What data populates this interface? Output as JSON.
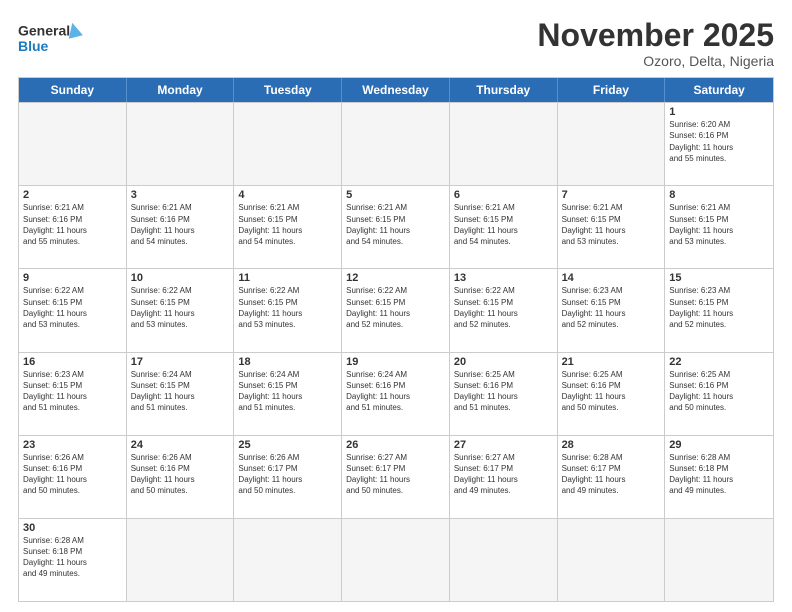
{
  "header": {
    "logo_general": "General",
    "logo_blue": "Blue",
    "month_title": "November 2025",
    "location": "Ozoro, Delta, Nigeria"
  },
  "days_of_week": [
    "Sunday",
    "Monday",
    "Tuesday",
    "Wednesday",
    "Thursday",
    "Friday",
    "Saturday"
  ],
  "weeks": [
    [
      {
        "day": "",
        "text": ""
      },
      {
        "day": "",
        "text": ""
      },
      {
        "day": "",
        "text": ""
      },
      {
        "day": "",
        "text": ""
      },
      {
        "day": "",
        "text": ""
      },
      {
        "day": "",
        "text": ""
      },
      {
        "day": "1",
        "text": "Sunrise: 6:20 AM\nSunset: 6:16 PM\nDaylight: 11 hours\nand 55 minutes."
      }
    ],
    [
      {
        "day": "2",
        "text": "Sunrise: 6:21 AM\nSunset: 6:16 PM\nDaylight: 11 hours\nand 55 minutes."
      },
      {
        "day": "3",
        "text": "Sunrise: 6:21 AM\nSunset: 6:16 PM\nDaylight: 11 hours\nand 54 minutes."
      },
      {
        "day": "4",
        "text": "Sunrise: 6:21 AM\nSunset: 6:15 PM\nDaylight: 11 hours\nand 54 minutes."
      },
      {
        "day": "5",
        "text": "Sunrise: 6:21 AM\nSunset: 6:15 PM\nDaylight: 11 hours\nand 54 minutes."
      },
      {
        "day": "6",
        "text": "Sunrise: 6:21 AM\nSunset: 6:15 PM\nDaylight: 11 hours\nand 54 minutes."
      },
      {
        "day": "7",
        "text": "Sunrise: 6:21 AM\nSunset: 6:15 PM\nDaylight: 11 hours\nand 53 minutes."
      },
      {
        "day": "8",
        "text": "Sunrise: 6:21 AM\nSunset: 6:15 PM\nDaylight: 11 hours\nand 53 minutes."
      }
    ],
    [
      {
        "day": "9",
        "text": "Sunrise: 6:22 AM\nSunset: 6:15 PM\nDaylight: 11 hours\nand 53 minutes."
      },
      {
        "day": "10",
        "text": "Sunrise: 6:22 AM\nSunset: 6:15 PM\nDaylight: 11 hours\nand 53 minutes."
      },
      {
        "day": "11",
        "text": "Sunrise: 6:22 AM\nSunset: 6:15 PM\nDaylight: 11 hours\nand 53 minutes."
      },
      {
        "day": "12",
        "text": "Sunrise: 6:22 AM\nSunset: 6:15 PM\nDaylight: 11 hours\nand 52 minutes."
      },
      {
        "day": "13",
        "text": "Sunrise: 6:22 AM\nSunset: 6:15 PM\nDaylight: 11 hours\nand 52 minutes."
      },
      {
        "day": "14",
        "text": "Sunrise: 6:23 AM\nSunset: 6:15 PM\nDaylight: 11 hours\nand 52 minutes."
      },
      {
        "day": "15",
        "text": "Sunrise: 6:23 AM\nSunset: 6:15 PM\nDaylight: 11 hours\nand 52 minutes."
      }
    ],
    [
      {
        "day": "16",
        "text": "Sunrise: 6:23 AM\nSunset: 6:15 PM\nDaylight: 11 hours\nand 51 minutes."
      },
      {
        "day": "17",
        "text": "Sunrise: 6:24 AM\nSunset: 6:15 PM\nDaylight: 11 hours\nand 51 minutes."
      },
      {
        "day": "18",
        "text": "Sunrise: 6:24 AM\nSunset: 6:15 PM\nDaylight: 11 hours\nand 51 minutes."
      },
      {
        "day": "19",
        "text": "Sunrise: 6:24 AM\nSunset: 6:16 PM\nDaylight: 11 hours\nand 51 minutes."
      },
      {
        "day": "20",
        "text": "Sunrise: 6:25 AM\nSunset: 6:16 PM\nDaylight: 11 hours\nand 51 minutes."
      },
      {
        "day": "21",
        "text": "Sunrise: 6:25 AM\nSunset: 6:16 PM\nDaylight: 11 hours\nand 50 minutes."
      },
      {
        "day": "22",
        "text": "Sunrise: 6:25 AM\nSunset: 6:16 PM\nDaylight: 11 hours\nand 50 minutes."
      }
    ],
    [
      {
        "day": "23",
        "text": "Sunrise: 6:26 AM\nSunset: 6:16 PM\nDaylight: 11 hours\nand 50 minutes."
      },
      {
        "day": "24",
        "text": "Sunrise: 6:26 AM\nSunset: 6:16 PM\nDaylight: 11 hours\nand 50 minutes."
      },
      {
        "day": "25",
        "text": "Sunrise: 6:26 AM\nSunset: 6:17 PM\nDaylight: 11 hours\nand 50 minutes."
      },
      {
        "day": "26",
        "text": "Sunrise: 6:27 AM\nSunset: 6:17 PM\nDaylight: 11 hours\nand 50 minutes."
      },
      {
        "day": "27",
        "text": "Sunrise: 6:27 AM\nSunset: 6:17 PM\nDaylight: 11 hours\nand 49 minutes."
      },
      {
        "day": "28",
        "text": "Sunrise: 6:28 AM\nSunset: 6:17 PM\nDaylight: 11 hours\nand 49 minutes."
      },
      {
        "day": "29",
        "text": "Sunrise: 6:28 AM\nSunset: 6:18 PM\nDaylight: 11 hours\nand 49 minutes."
      }
    ],
    [
      {
        "day": "30",
        "text": "Sunrise: 6:28 AM\nSunset: 6:18 PM\nDaylight: 11 hours\nand 49 minutes."
      },
      {
        "day": "",
        "text": ""
      },
      {
        "day": "",
        "text": ""
      },
      {
        "day": "",
        "text": ""
      },
      {
        "day": "",
        "text": ""
      },
      {
        "day": "",
        "text": ""
      },
      {
        "day": "",
        "text": ""
      }
    ]
  ]
}
